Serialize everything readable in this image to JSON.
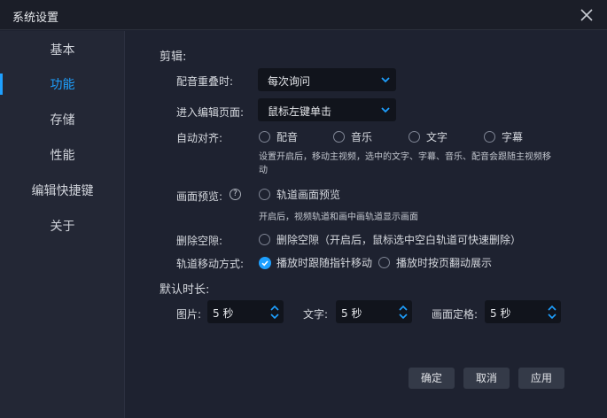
{
  "window": {
    "title": "系统设置"
  },
  "sidebar": {
    "items": [
      {
        "label": "基本"
      },
      {
        "label": "功能"
      },
      {
        "label": "存储"
      },
      {
        "label": "性能"
      },
      {
        "label": "编辑快捷键"
      },
      {
        "label": "关于"
      }
    ],
    "active_index": 1
  },
  "edit": {
    "section_title": "剪辑:",
    "overlap": {
      "label": "配音重叠时:",
      "value": "每次询问"
    },
    "enter_edit": {
      "label": "进入编辑页面:",
      "value": "鼠标左键单击"
    },
    "auto_align": {
      "label": "自动对齐:",
      "options": [
        "配音",
        "音乐",
        "文字",
        "字幕"
      ],
      "hint": "设置开启后，移动主视频，选中的文字、字幕、音乐、配音会跟随主视频移动"
    },
    "preview": {
      "label": "画面预览:",
      "help_icon": "question-circle-icon",
      "option": "轨道画面预览",
      "hint": "开启后，视频轨道和画中画轨道显示画面"
    },
    "gap": {
      "label": "删除空隙:",
      "option": "删除空隙（开启后，鼠标选中空白轨道可快速删除）"
    },
    "track_move": {
      "label": "轨道移动方式:",
      "options": [
        "播放时跟随指针移动",
        "播放时按页翻动展示"
      ],
      "selected_index": 0
    }
  },
  "duration": {
    "section_title": "默认时长:",
    "image": {
      "label": "图片:",
      "value": "5 秒"
    },
    "text": {
      "label": "文字:",
      "value": "5 秒"
    },
    "freeze": {
      "label": "画面定格:",
      "value": "5 秒"
    }
  },
  "footer": {
    "ok": "确定",
    "cancel": "取消",
    "apply": "应用"
  },
  "colors": {
    "accent": "#1ea0ff",
    "background": "#1e2230",
    "sidebar": "#232735",
    "input": "#11141c",
    "button": "#343a48"
  }
}
